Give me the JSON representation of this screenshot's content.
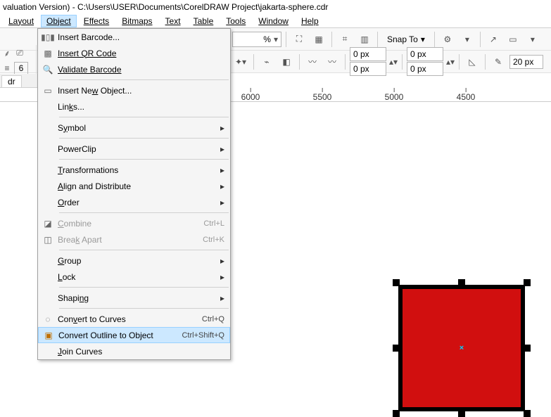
{
  "title": "valuation Version) - C:\\Users\\USER\\Documents\\CorelDRAW Project\\jakarta-sphere.cdr",
  "menubar": {
    "layout": "Layout",
    "object": "Object",
    "effects": "Effects",
    "bitmaps": "Bitmaps",
    "text": "Text",
    "table": "Table",
    "tools": "Tools",
    "window": "Window",
    "help": "Help"
  },
  "toolbar": {
    "zoom_value": "",
    "zoom_unit": "%",
    "snap_to": "Snap To"
  },
  "propbar": {
    "px0_a": "0 px",
    "px0_b": "0 px",
    "px0_c": "0 px",
    "px0_d": "0 px",
    "px20": "20 px"
  },
  "side": {
    "n1": "6"
  },
  "doc_tab": "dr",
  "ruler": {
    "t6000": "6000",
    "t5500": "5500",
    "t5000": "5000",
    "t4500": "4500"
  },
  "menu": {
    "insert_barcode": "Insert Barcode...",
    "insert_qr": "Insert QR Code",
    "validate_barcode": "Validate Barcode",
    "insert_new_object": "Insert New Object...",
    "links": "Links...",
    "symbol": "Symbol",
    "powerclip": "PowerClip",
    "transformations": "Transformations",
    "align": "Align and Distribute",
    "order": "Order",
    "combine": "Combine",
    "combine_sc": "Ctrl+L",
    "break": "Break Apart",
    "break_sc": "Ctrl+K",
    "group": "Group",
    "lock": "Lock",
    "shaping": "Shaping",
    "to_curves": "Convert to Curves",
    "to_curves_sc": "Ctrl+Q",
    "outline_obj": "Convert Outline to Object",
    "outline_obj_sc": "Ctrl+Shift+Q",
    "join_curves": "Join Curves"
  }
}
